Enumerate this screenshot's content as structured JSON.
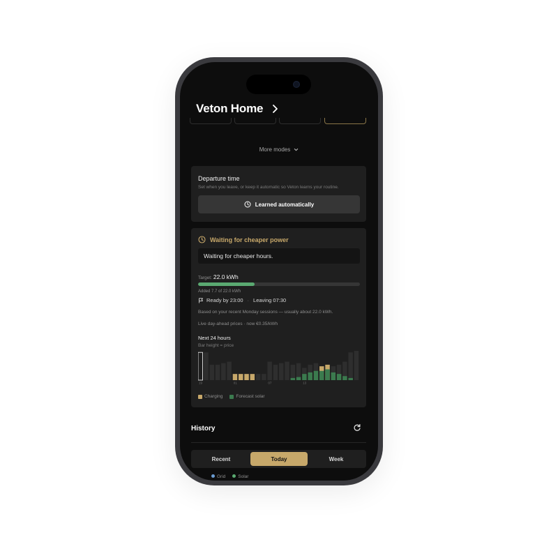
{
  "header": {
    "title": "Veton Home"
  },
  "modes": {
    "more_label": "More modes"
  },
  "departure": {
    "title": "Departure time",
    "subtitle": "Set when you leave, or keep it automatic so Veton learns your routine.",
    "button_label": "Learned automatically"
  },
  "charging": {
    "status_title": "Waiting for cheaper power",
    "status_message": "Waiting for cheaper hours.",
    "target_label": "Target:",
    "target_value": "22.0 kWh",
    "progress_fraction": 0.35,
    "added_text": "Added 7.7 of 22.0 kWh",
    "ready_text": "Ready by 23:00",
    "separator": "·",
    "leaving_text": "Leaving 07:30",
    "basis_text": "Based on your recent Monday sessions — usually about 22.0 kWh.",
    "prices_text": "Live day-ahead prices · now €0.35/kWh",
    "chart_title": "Next 24 hours",
    "chart_subtitle": "Bar height = price",
    "legend_charging": "Charging",
    "legend_solar": "Forecast solar"
  },
  "history": {
    "title": "History",
    "tabs": [
      "Recent",
      "Today",
      "Week"
    ],
    "active_tab": 1,
    "legend": [
      "Grid",
      "Solar"
    ]
  },
  "colors": {
    "accent": "#c7a86a",
    "progress": "#5aa971",
    "solar": "#3b7a4e",
    "bar": "#2e2e2e"
  },
  "chart_data": {
    "type": "bar",
    "title": "Next 24 hours",
    "subtitle": "Bar height = price",
    "tick_labels": [
      "19",
      "01",
      "07",
      "13"
    ],
    "values": [
      9,
      9,
      5,
      5,
      5.5,
      6,
      2,
      2,
      2,
      2,
      2,
      2,
      6,
      5,
      5.5,
      6,
      5,
      5.5,
      4,
      5,
      5.5,
      4.5,
      5,
      4.5,
      5,
      6,
      9,
      9.5
    ],
    "charging": [
      false,
      false,
      false,
      false,
      false,
      false,
      true,
      true,
      true,
      true,
      false,
      false,
      false,
      false,
      false,
      false,
      false,
      false,
      false,
      false,
      false,
      true,
      true,
      false,
      false,
      false,
      false,
      false
    ],
    "solar": [
      0,
      0,
      0,
      0,
      0,
      0,
      0,
      0,
      0,
      0,
      0,
      0,
      0,
      0,
      0,
      0,
      0.7,
      1,
      2,
      2.5,
      3,
      3,
      3.5,
      2.5,
      2,
      1.3,
      0.7,
      0
    ],
    "current_index": 0,
    "legend": [
      "Charging",
      "Forecast solar"
    ]
  }
}
